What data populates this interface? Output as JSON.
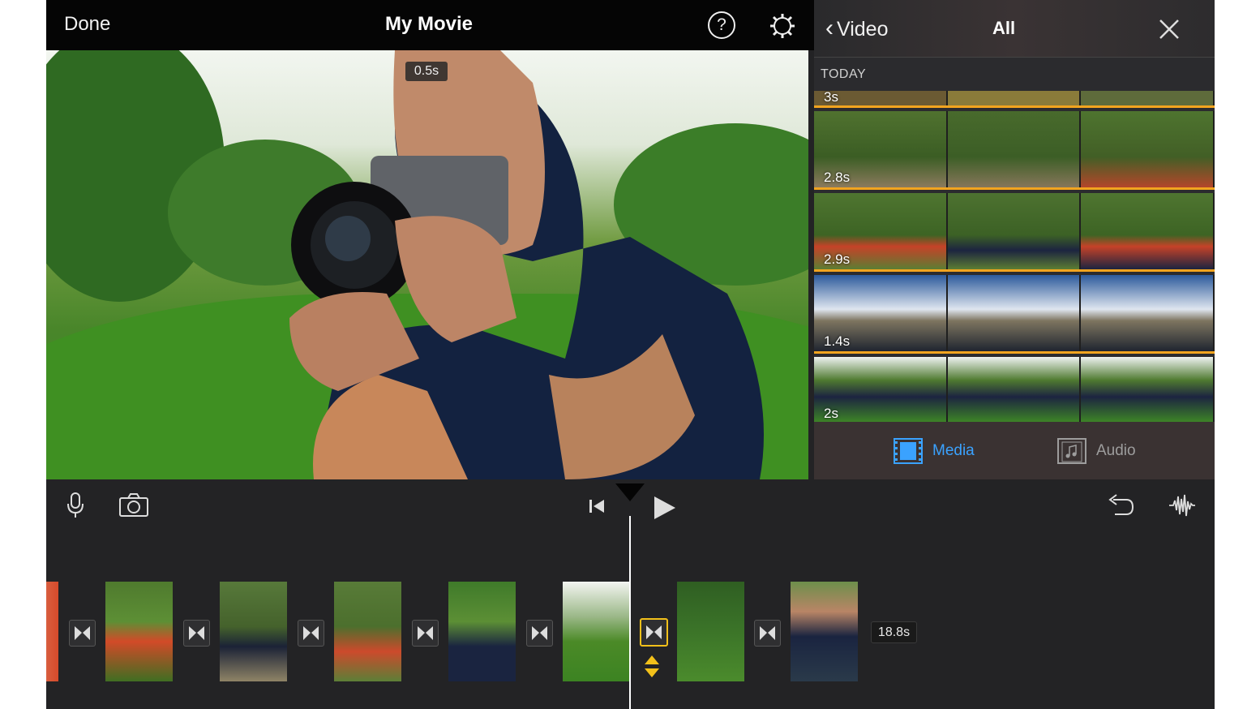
{
  "topbar": {
    "done_label": "Done",
    "title": "My Movie",
    "help_label": "?"
  },
  "viewer": {
    "duration_badge": "0.5s"
  },
  "browser": {
    "back_label": "Video",
    "filter_label": "All",
    "section_label": "TODAY",
    "clips": [
      {
        "duration": "3s"
      },
      {
        "duration": "2.8s"
      },
      {
        "duration": "2.9s"
      },
      {
        "duration": "1.4s"
      },
      {
        "duration": "2s"
      }
    ],
    "tabs": [
      {
        "label": "Media",
        "state": "active"
      },
      {
        "label": "Audio",
        "state": "inactive"
      }
    ]
  },
  "timeline": {
    "total_duration": "18.8s",
    "clip_count": 8,
    "transition_count": 7
  },
  "colors": {
    "accent_blue": "#3aa2ff",
    "clip_border_orange": "#f2a41f",
    "selection_yellow": "#f2c01a"
  },
  "icons": [
    "help-icon",
    "gear-icon",
    "chevron-left-icon",
    "close-icon",
    "media-film-icon",
    "audio-note-icon",
    "microphone-icon",
    "camera-icon",
    "skip-to-start-icon",
    "play-icon",
    "undo-icon",
    "waveform-icon",
    "transition-icon"
  ]
}
